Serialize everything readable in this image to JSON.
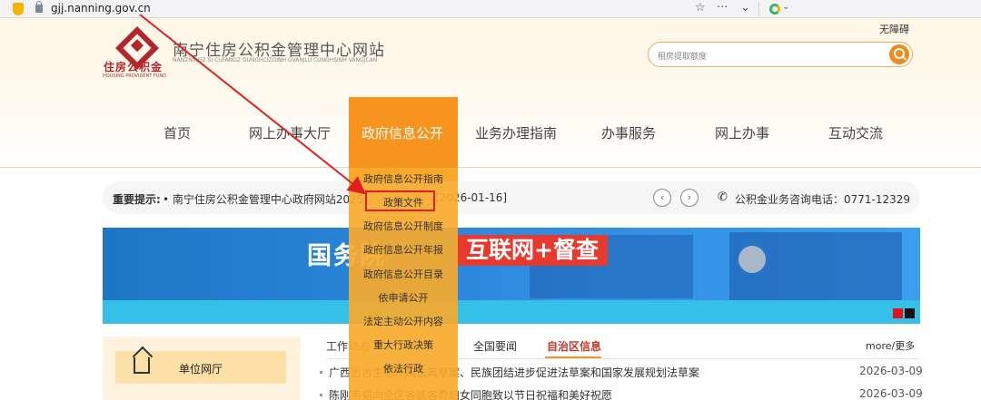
{
  "browser": {
    "url": "gjj.nanning.gov.cn",
    "star_icon": "☆",
    "menu_icon": "···",
    "chevron_icon": "⌄",
    "engine_caret": "⌄"
  },
  "header": {
    "logo_text": "住房公积金",
    "logo_sub": "HOUSING PROVIDENT FUND",
    "site_title": "南宁住房公积金管理中心网站",
    "site_pinyin": "NANZNINGZ SI CUFANGZ GUNGHCIZGINH GVANJLU CUNGHSINH VANGJCAN",
    "accessibility": "无障碍",
    "search_placeholder": "租房提取额度"
  },
  "nav": {
    "items": [
      "首页",
      "网上办事大厅",
      "政府信息公开",
      "业务办理指南",
      "办事服务",
      "网上办事",
      "互动交流"
    ],
    "active_index": 2
  },
  "dropdown": {
    "items": [
      "政府信息公开指南",
      "政策文件",
      "政府信息公开制度",
      "政府信息公开年报",
      "政府信息公开目录",
      "依申请公开",
      "法定主动公开内容",
      "重大行政决策",
      "依法行政"
    ],
    "highlighted": "政策文件"
  },
  "notice": {
    "label": "重要提示:",
    "text": "• 南宁住房公积金管理中心政府网站2025",
    "date": "[2026-01-16]",
    "prev": "‹",
    "next": "›",
    "phone_icon": "✆",
    "phone": "公积金业务咨询电话：0771-12329"
  },
  "banner": {
    "text1": "国务院",
    "text2": "互联网+督查"
  },
  "left_panel": {
    "unit_label": "单位网厅"
  },
  "news": {
    "tabs": [
      "工作动态",
      "全国要闻",
      "自治区信息"
    ],
    "active_tab": "自治区信息",
    "more": "more/更多",
    "items": [
      {
        "title": "广西出台生态环境法典草案、民族团结进步促进法草案和国家发展规划法草案",
        "date": "2026-03-09"
      },
      {
        "title": "陈刚韦韬向全区各族各界妇女同胞致以节日祝福和美好祝愿",
        "date": "2026-03-09"
      }
    ]
  },
  "colors": {
    "accent": "#f7941d",
    "logo_red": "#b3262b",
    "highlight_red": "#e02020"
  }
}
